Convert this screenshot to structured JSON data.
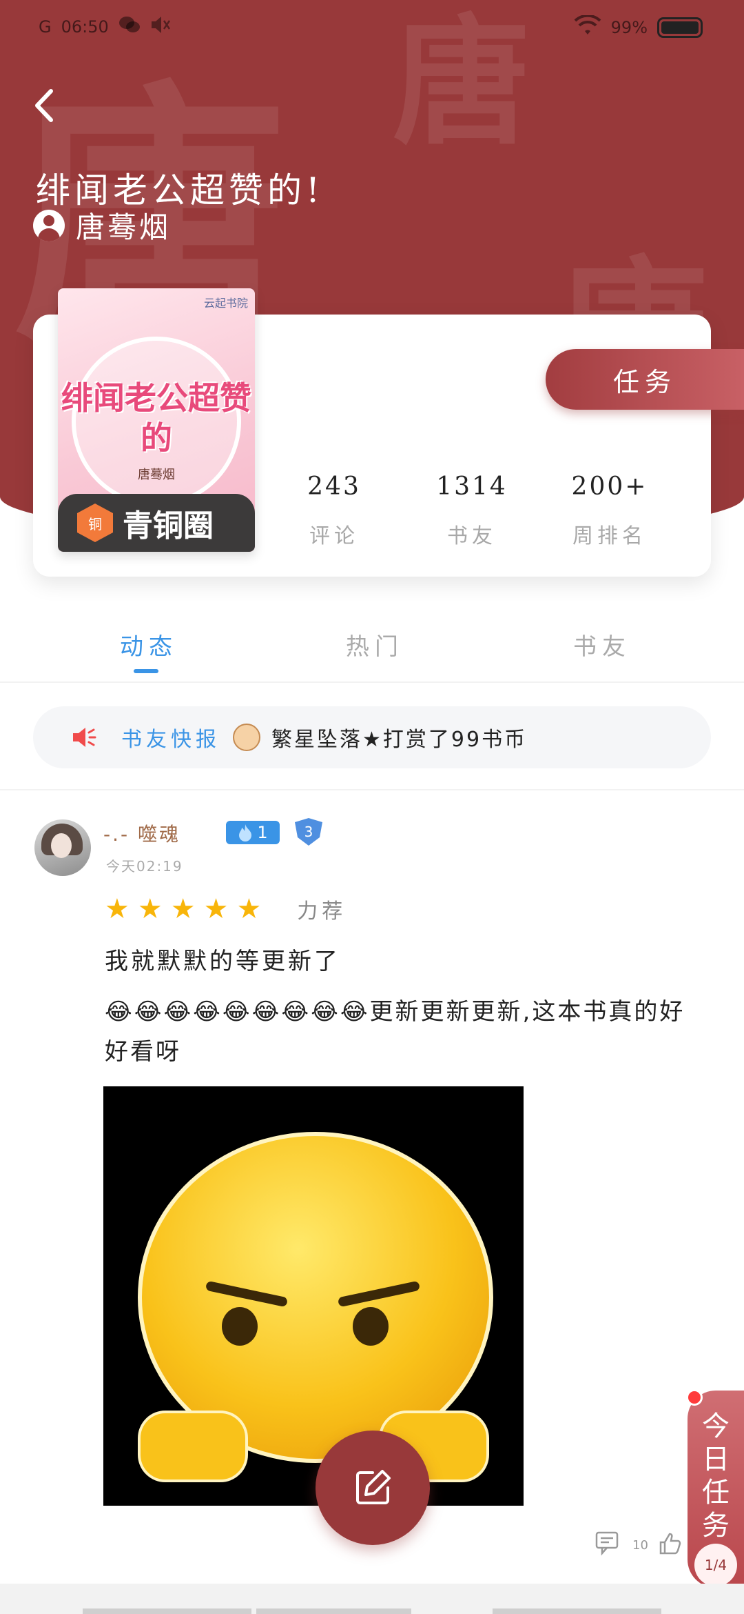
{
  "header": {
    "watermark": "唐",
    "title": "绯闻老公超赞的!",
    "author": "唐蓦烟"
  },
  "statusbar": {
    "signal": "G",
    "time": "06:50",
    "battery": "99%"
  },
  "book": {
    "cover_publisher": "云起书院",
    "cover_title": "绯闻老公超赞的",
    "cover_author": "唐蓦烟",
    "badge_icon_text": "铜",
    "badge_label": "青铜圈"
  },
  "task_button": "任务",
  "stats": [
    {
      "value": "243",
      "label": "评论"
    },
    {
      "value": "1314",
      "label": "书友"
    },
    {
      "value": "200+",
      "label": "周排名"
    }
  ],
  "tabs": [
    {
      "label": "动态",
      "active": true
    },
    {
      "label": "热门",
      "active": false
    },
    {
      "label": "书友",
      "active": false
    }
  ],
  "news": {
    "label": "书友快报",
    "text": "繁星坠落★打赏了99书币"
  },
  "post": {
    "username": "-.- 噬魂",
    "level": "1",
    "shield_level": "3",
    "time": "今天02:19",
    "rating": 5,
    "rating_label": "力荐",
    "line1": "我就默默的等更新了",
    "line2": "😂😂😂😂😂😂😂😂😂更新更新更新,这本书真的好好看呀",
    "comments": "10"
  },
  "daily_task": {
    "label": "今日任务",
    "progress": "1/4"
  },
  "colors": {
    "brand": "#98393a",
    "accent_blue": "#3a94e6",
    "star": "#f8b50a"
  }
}
